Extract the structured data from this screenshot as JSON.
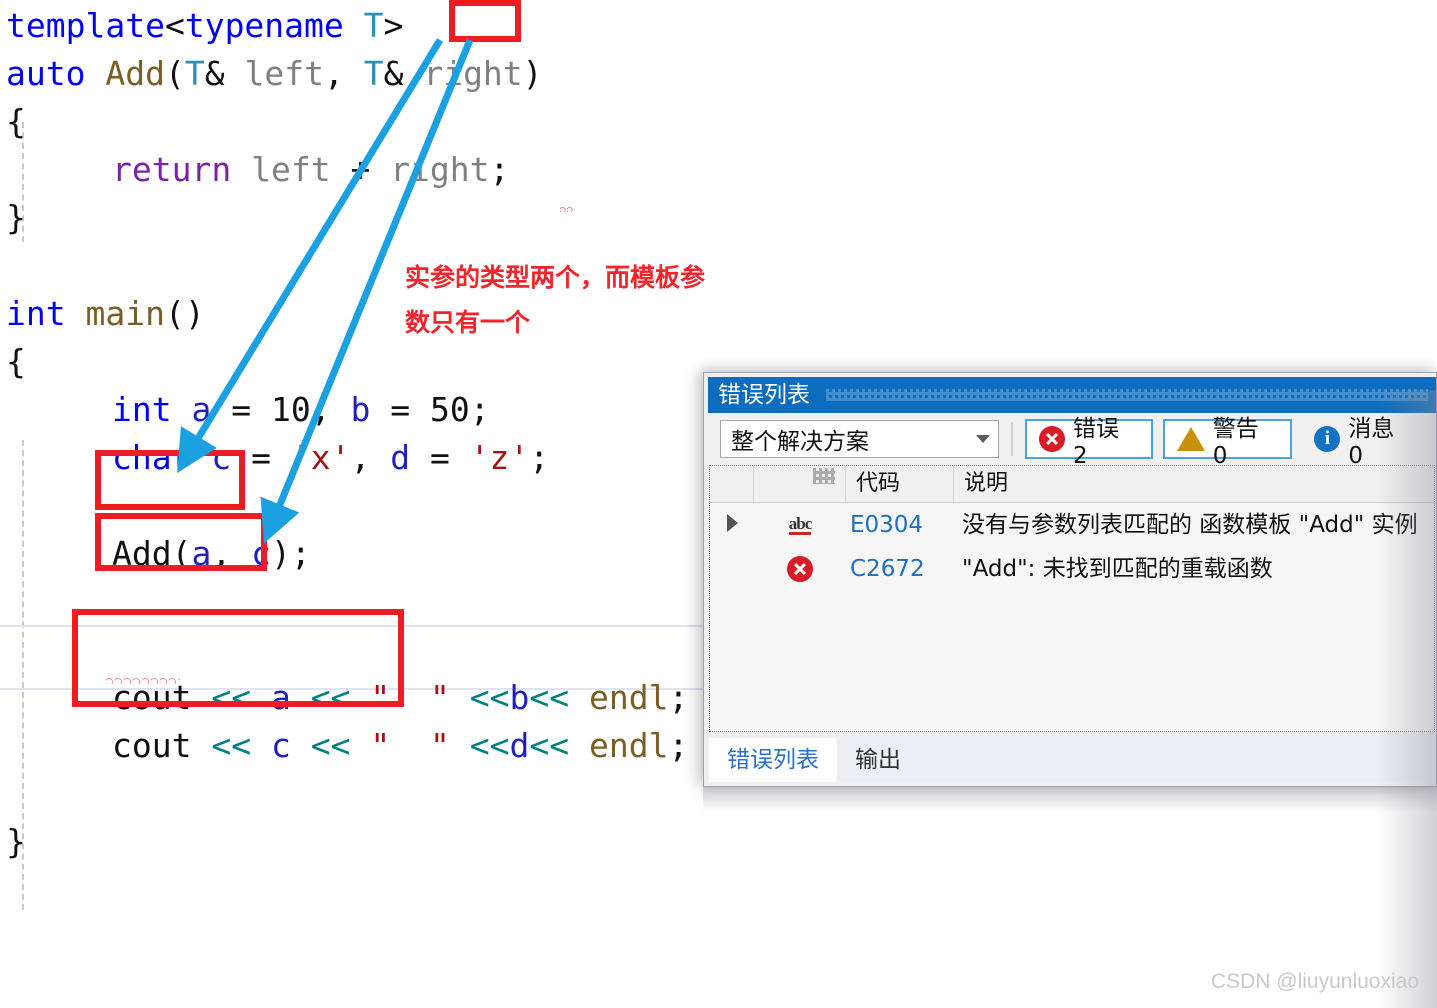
{
  "editor": {
    "language": "cpp",
    "lines": [
      {
        "indent": 0,
        "tokens": [
          {
            "t": "template",
            "c": "kw"
          },
          {
            "t": "<",
            "c": "punc"
          },
          {
            "t": "typename",
            "c": "kw"
          },
          {
            "t": " ",
            "c": "plain"
          },
          {
            "t": "T",
            "c": "type"
          },
          {
            "t": ">",
            "c": "punc"
          }
        ]
      },
      {
        "indent": 0,
        "tokens": [
          {
            "t": "auto",
            "c": "kw"
          },
          {
            "t": " ",
            "c": "plain"
          },
          {
            "t": "Add",
            "c": "fn"
          },
          {
            "t": "(",
            "c": "punc"
          },
          {
            "t": "T",
            "c": "type"
          },
          {
            "t": "&",
            "c": "plain"
          },
          {
            "t": " ",
            "c": "plain"
          },
          {
            "t": "left",
            "c": "gray"
          },
          {
            "t": ", ",
            "c": "punc"
          },
          {
            "t": "T",
            "c": "type"
          },
          {
            "t": "&",
            "c": "plain"
          },
          {
            "t": " ",
            "c": "plain"
          },
          {
            "t": "right",
            "c": "gray"
          },
          {
            "t": ")",
            "c": "punc"
          }
        ]
      },
      {
        "indent": 0,
        "tokens": [
          {
            "t": "{",
            "c": "brace"
          }
        ]
      },
      {
        "indent": 1,
        "tokens": [
          {
            "t": "return",
            "c": "kw2"
          },
          {
            "t": " ",
            "c": "plain"
          },
          {
            "t": "left",
            "c": "gray"
          },
          {
            "t": " + ",
            "c": "plain"
          },
          {
            "t": "right",
            "c": "gray"
          },
          {
            "t": ";",
            "c": "punc"
          }
        ]
      },
      {
        "indent": 0,
        "tokens": [
          {
            "t": "}",
            "c": "brace"
          }
        ]
      },
      {
        "indent": 0,
        "tokens": []
      },
      {
        "indent": 0,
        "tokens": [
          {
            "t": "int",
            "c": "kw"
          },
          {
            "t": " ",
            "c": "plain"
          },
          {
            "t": "main",
            "c": "fn"
          },
          {
            "t": "()",
            "c": "punc"
          }
        ]
      },
      {
        "indent": 0,
        "tokens": [
          {
            "t": "{",
            "c": "brace"
          }
        ]
      },
      {
        "indent": 1,
        "tokens": [
          {
            "t": "int",
            "c": "kw"
          },
          {
            "t": " ",
            "c": "plain"
          },
          {
            "t": "a",
            "c": "var"
          },
          {
            "t": " = ",
            "c": "plain"
          },
          {
            "t": "10",
            "c": "plain"
          },
          {
            "t": ", ",
            "c": "punc"
          },
          {
            "t": "b",
            "c": "var"
          },
          {
            "t": " = ",
            "c": "plain"
          },
          {
            "t": "50",
            "c": "plain"
          },
          {
            "t": ";",
            "c": "punc"
          }
        ]
      },
      {
        "indent": 1,
        "tokens": [
          {
            "t": "char",
            "c": "kw"
          },
          {
            "t": " ",
            "c": "plain"
          },
          {
            "t": "c",
            "c": "var"
          },
          {
            "t": " = ",
            "c": "plain"
          },
          {
            "t": "'x'",
            "c": "str"
          },
          {
            "t": ", ",
            "c": "punc"
          },
          {
            "t": "d",
            "c": "var"
          },
          {
            "t": " = ",
            "c": "plain"
          },
          {
            "t": "'z'",
            "c": "str"
          },
          {
            "t": ";",
            "c": "punc"
          }
        ]
      },
      {
        "indent": 1,
        "tokens": []
      },
      {
        "indent": 1,
        "tokens": [
          {
            "t": "Add",
            "c": "plain"
          },
          {
            "t": "(",
            "c": "punc"
          },
          {
            "t": "a",
            "c": "var"
          },
          {
            "t": ", ",
            "c": "punc"
          },
          {
            "t": "c",
            "c": "var"
          },
          {
            "t": ")",
            "c": "punc"
          },
          {
            "t": ";",
            "c": "punc"
          }
        ]
      },
      {
        "indent": 1,
        "tokens": []
      },
      {
        "indent": 1,
        "tokens": []
      },
      {
        "indent": 1,
        "tokens": [
          {
            "t": "cout",
            "c": "plain"
          },
          {
            "t": " ",
            "c": "plain"
          },
          {
            "t": "<<",
            "c": "op"
          },
          {
            "t": " ",
            "c": "plain"
          },
          {
            "t": "a",
            "c": "var"
          },
          {
            "t": " ",
            "c": "plain"
          },
          {
            "t": "<<",
            "c": "op"
          },
          {
            "t": " ",
            "c": "plain"
          },
          {
            "t": "\"  \"",
            "c": "str"
          },
          {
            "t": " ",
            "c": "plain"
          },
          {
            "t": "<<",
            "c": "op"
          },
          {
            "t": "b",
            "c": "var"
          },
          {
            "t": "<<",
            "c": "op"
          },
          {
            "t": " ",
            "c": "plain"
          },
          {
            "t": "endl",
            "c": "fn"
          },
          {
            "t": ";",
            "c": "punc"
          }
        ]
      },
      {
        "indent": 1,
        "tokens": [
          {
            "t": "cout",
            "c": "plain"
          },
          {
            "t": " ",
            "c": "plain"
          },
          {
            "t": "<<",
            "c": "op"
          },
          {
            "t": " ",
            "c": "plain"
          },
          {
            "t": "c",
            "c": "var"
          },
          {
            "t": " ",
            "c": "plain"
          },
          {
            "t": "<<",
            "c": "op"
          },
          {
            "t": " ",
            "c": "plain"
          },
          {
            "t": "\"  \"",
            "c": "str"
          },
          {
            "t": " ",
            "c": "plain"
          },
          {
            "t": "<<",
            "c": "op"
          },
          {
            "t": "d",
            "c": "var"
          },
          {
            "t": "<<",
            "c": "op"
          },
          {
            "t": " ",
            "c": "plain"
          },
          {
            "t": "endl",
            "c": "fn"
          },
          {
            "t": ";",
            "c": "punc"
          }
        ]
      },
      {
        "indent": 0,
        "tokens": []
      },
      {
        "indent": 0,
        "tokens": [
          {
            "t": "}",
            "c": "brace"
          }
        ]
      }
    ]
  },
  "annotation": {
    "note_line1": "实参的类型两个，而模板参",
    "note_line2": "数只有一个",
    "color": "#f1252b",
    "arrow_color": "#1ba1e2",
    "box_color": "#ee1c25",
    "boxes": [
      {
        "label": "T>"
      },
      {
        "label": "int a"
      },
      {
        "label": "char c"
      },
      {
        "label": "Add(a, c);"
      },
      {
        "label": "\"Add\": 未找到匹配的重载函数"
      }
    ]
  },
  "error_panel": {
    "title": "错误列表",
    "scope": {
      "value": "整个解决方案",
      "caret_icon": "chevron-down-icon"
    },
    "filters": [
      {
        "icon": "error-icon",
        "label": "错误 2",
        "active": true
      },
      {
        "icon": "warning-icon",
        "label": "警告 0",
        "active": true
      },
      {
        "icon": "info-icon",
        "label": "消息 0",
        "active": false
      }
    ],
    "columns": [
      "",
      "",
      "代码",
      "说明"
    ],
    "rows": [
      {
        "expander": "expand-triangle-icon",
        "severity_icon": "intellisense-abc-icon",
        "code": "E0304",
        "description": "没有与参数列表匹配的 函数模板 \"Add\" 实例",
        "highlighted": false
      },
      {
        "expander": "",
        "severity_icon": "error-icon",
        "code": "C2672",
        "description": "\"Add\": 未找到匹配的重载函数",
        "highlighted": true
      }
    ],
    "tabs": [
      {
        "label": "错误列表",
        "active": true
      },
      {
        "label": "输出",
        "active": false
      }
    ]
  },
  "watermark": {
    "text": "CSDN @liuyunluoxiao"
  }
}
